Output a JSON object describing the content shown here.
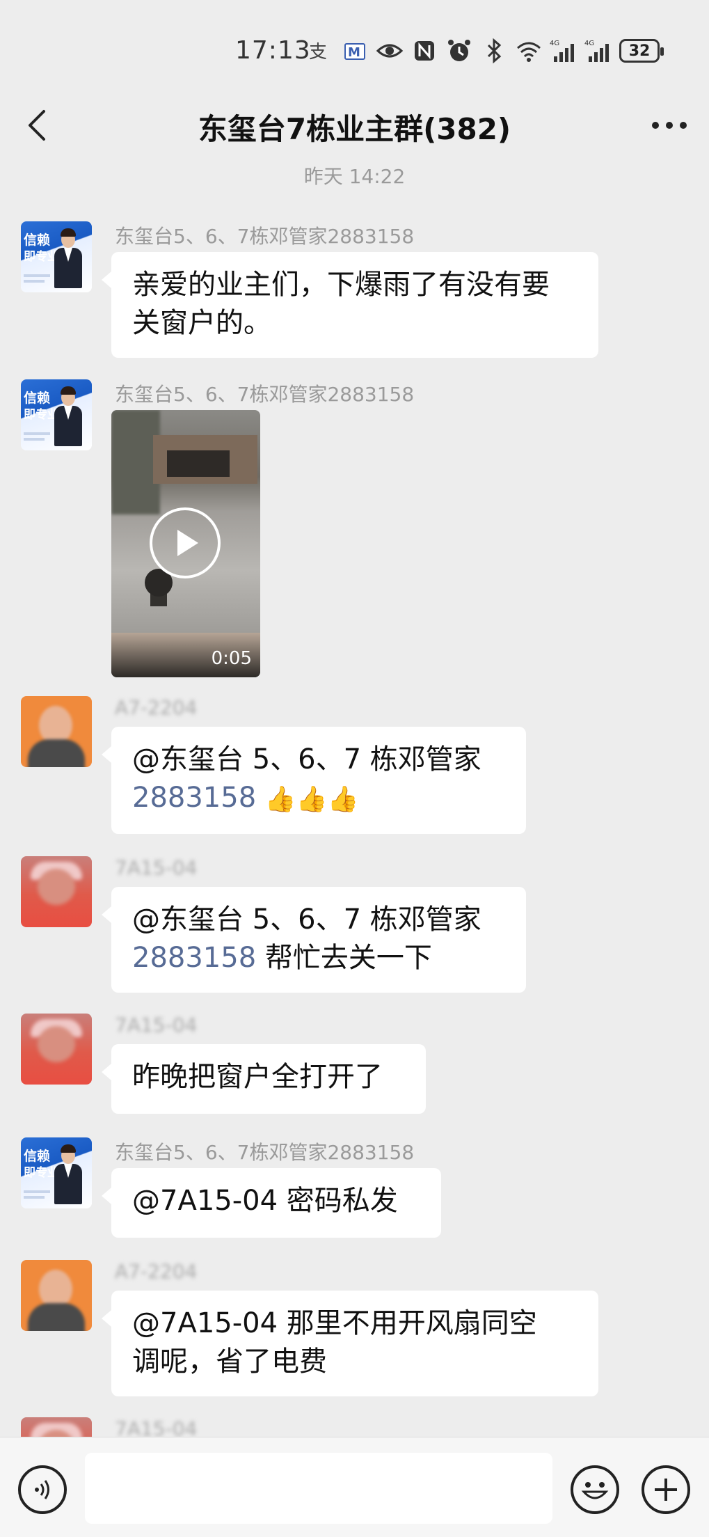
{
  "status_bar": {
    "time": "17:13",
    "battery": "32"
  },
  "nav": {
    "title": "东玺台7栋业主群(382)"
  },
  "time_divider": "昨天 14:22",
  "messages": [
    {
      "sender": "东玺台5、6、7栋邓管家2883158",
      "type": "text",
      "text_lines": [
        "亲爱的业主们，下爆雨了有没有要",
        "关窗户的。"
      ]
    },
    {
      "sender": "东玺台5、6、7栋邓管家2883158",
      "type": "video",
      "duration": "0:05"
    },
    {
      "sender": "A7-2204",
      "type": "text",
      "line1": "@东玺台 5、6、7 栋邓管家",
      "mention_num": "2883158",
      "suffix": "👍👍👍"
    },
    {
      "sender": "7A15-04",
      "type": "text",
      "line1": "@东玺台 5、6、7 栋邓管家",
      "mention_num": "2883158",
      "suffix": " 帮忙去关一下"
    },
    {
      "sender": "7A15-04",
      "type": "text",
      "text": "昨晚把窗户全打开了"
    },
    {
      "sender": "东玺台5、6、7栋邓管家2883158",
      "type": "text",
      "text": "@7A15-04  密码私发"
    },
    {
      "sender": "A7-2204",
      "type": "text",
      "text_lines": [
        "@7A15-04  那里不用开风扇同空",
        "调呢，省了电费"
      ]
    },
    {
      "sender": "7A15-04",
      "type": "partial"
    }
  ],
  "avatar_badge": {
    "line1": "信赖",
    "line2": "即专业"
  },
  "input_bar": {
    "value": ""
  }
}
